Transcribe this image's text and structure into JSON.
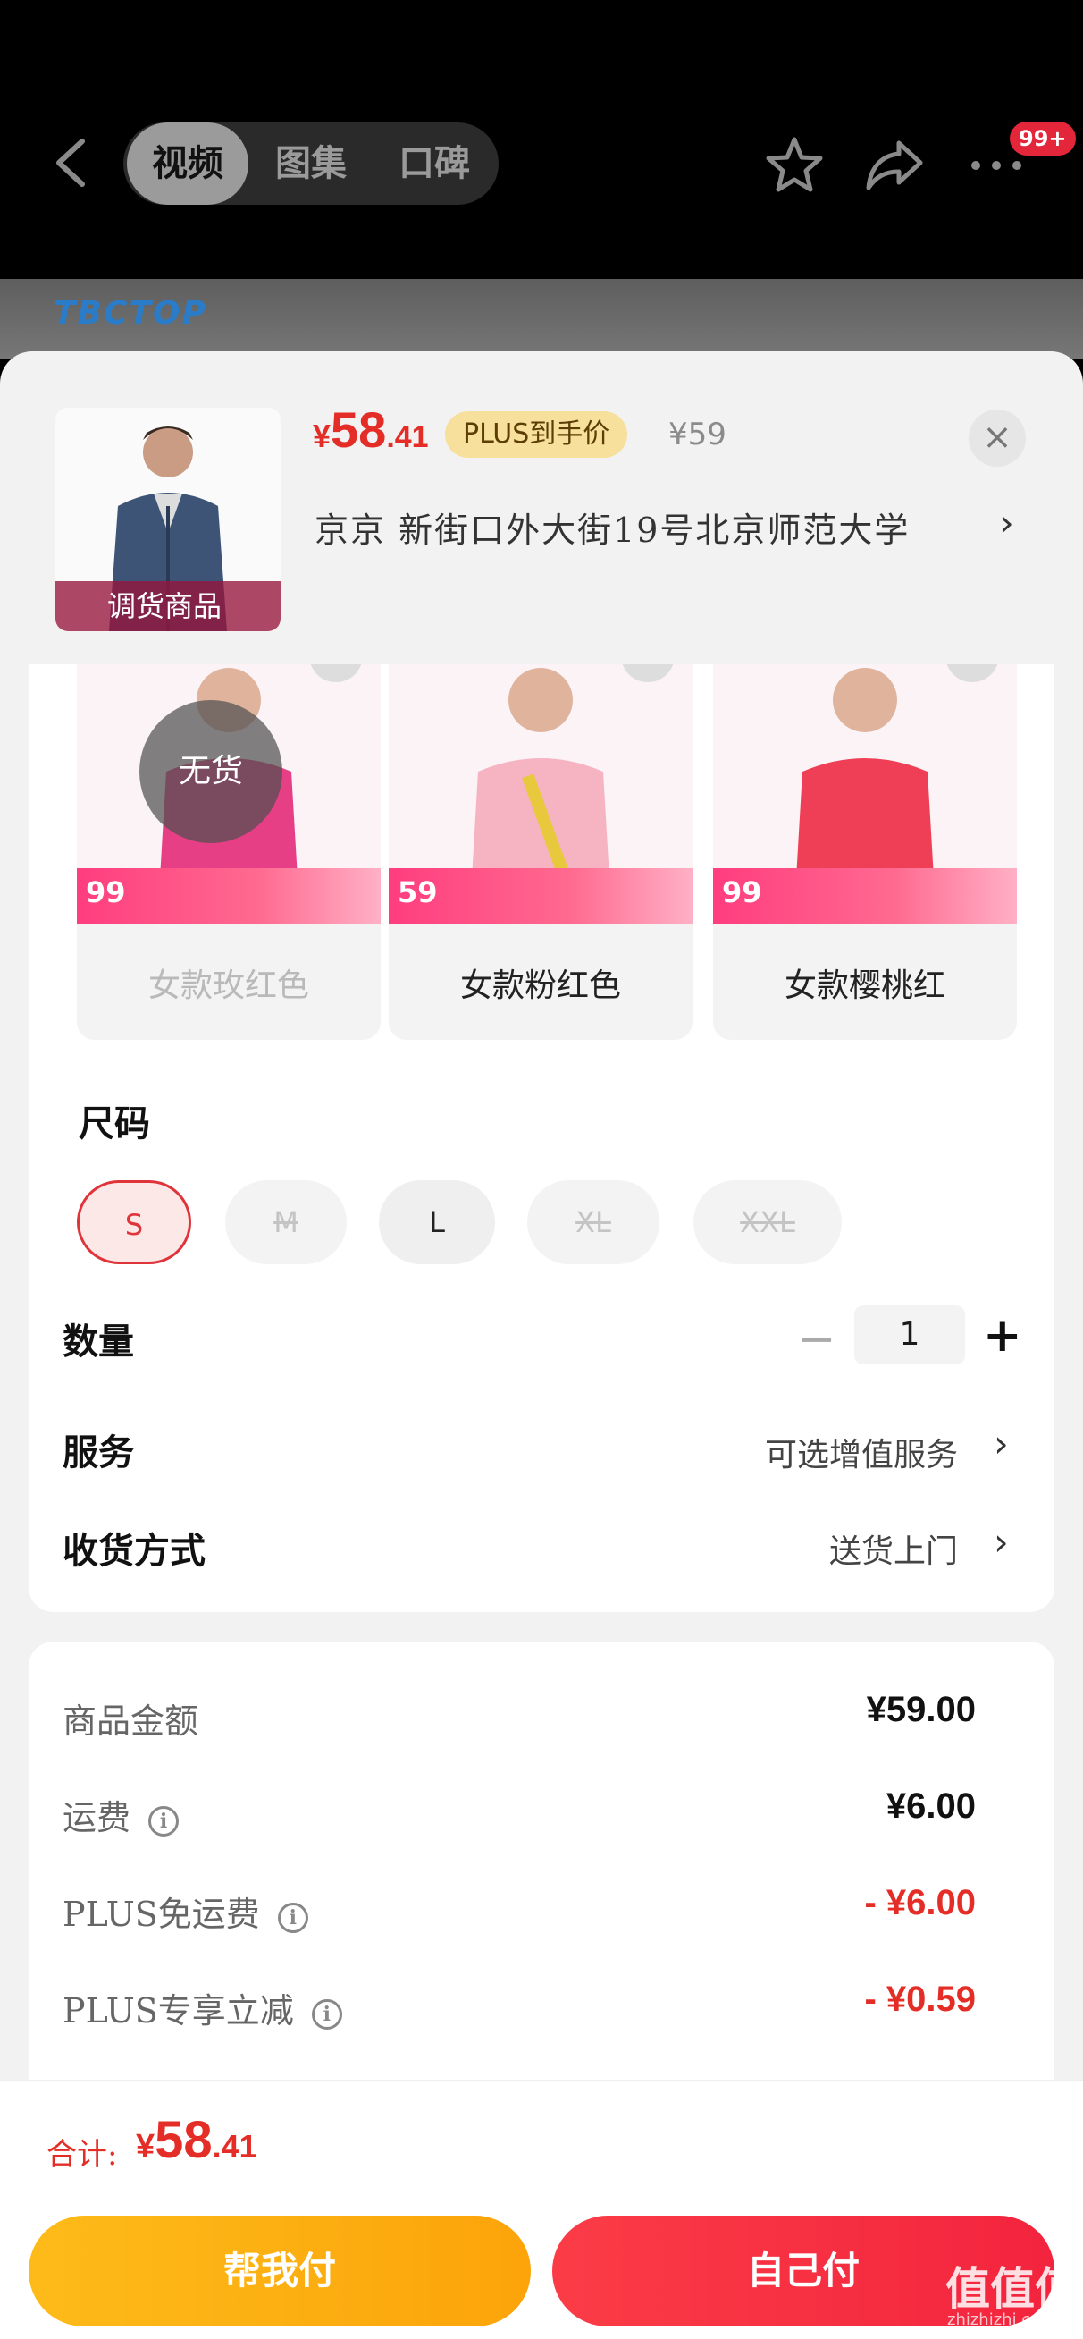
{
  "topbar": {
    "tabs": [
      "视频",
      "图集",
      "口碑"
    ],
    "badge": "99+",
    "icons": [
      "back-arrow-icon",
      "star-icon",
      "share-icon",
      "more-icon"
    ]
  },
  "product": {
    "price_yen": "¥",
    "price_int": "58",
    "price_dec": ".41",
    "plus_label": "PLUS到手价",
    "original_price": "¥59",
    "thumb_tag": "调货商品",
    "address": "京京   新街口外大街19号北京师范大学",
    "background_logo": "TBCTOP"
  },
  "colors": [
    {
      "label": "女款玫红色",
      "price": "99",
      "available": false,
      "nostock": "无货"
    },
    {
      "label": "女款粉红色",
      "price": "59",
      "available": true
    },
    {
      "label": "女款樱桃红",
      "price": "99",
      "available": true
    }
  ],
  "size_section": {
    "title": "尺码",
    "sizes": [
      {
        "label": "S",
        "state": "selected"
      },
      {
        "label": "M",
        "state": "disabled"
      },
      {
        "label": "L",
        "state": "available"
      },
      {
        "label": "XL",
        "state": "disabled"
      },
      {
        "label": "XXL",
        "state": "disabled"
      }
    ]
  },
  "quantity": {
    "label": "数量",
    "value": "1",
    "minus": "−",
    "plus": "+"
  },
  "service": {
    "label": "服务",
    "value": "可选增值服务"
  },
  "delivery": {
    "label": "收货方式",
    "value": "送货上门"
  },
  "price_detail": [
    {
      "label": "商品金额",
      "value": "¥59.00",
      "info": false,
      "red": false
    },
    {
      "label": "运费",
      "value": "¥6.00",
      "info": true,
      "red": false
    },
    {
      "label": "PLUS免运费",
      "value": "- ¥6.00",
      "info": true,
      "red": true
    },
    {
      "label": "PLUS专享立减",
      "value": "- ¥0.59",
      "info": true,
      "red": true
    }
  ],
  "bottom": {
    "total_label": "合计:",
    "total_yen": "¥",
    "total_int": "58",
    "total_dec": ".41",
    "help_pay": "帮我付",
    "self_pay": "自己付",
    "watermark": "值值值",
    "watermark_url": "zhizhizhi.com"
  },
  "colors_theme": {
    "accent": "#e52d27",
    "yellow": "#fdbb19",
    "red_btn": "#f3243e"
  }
}
